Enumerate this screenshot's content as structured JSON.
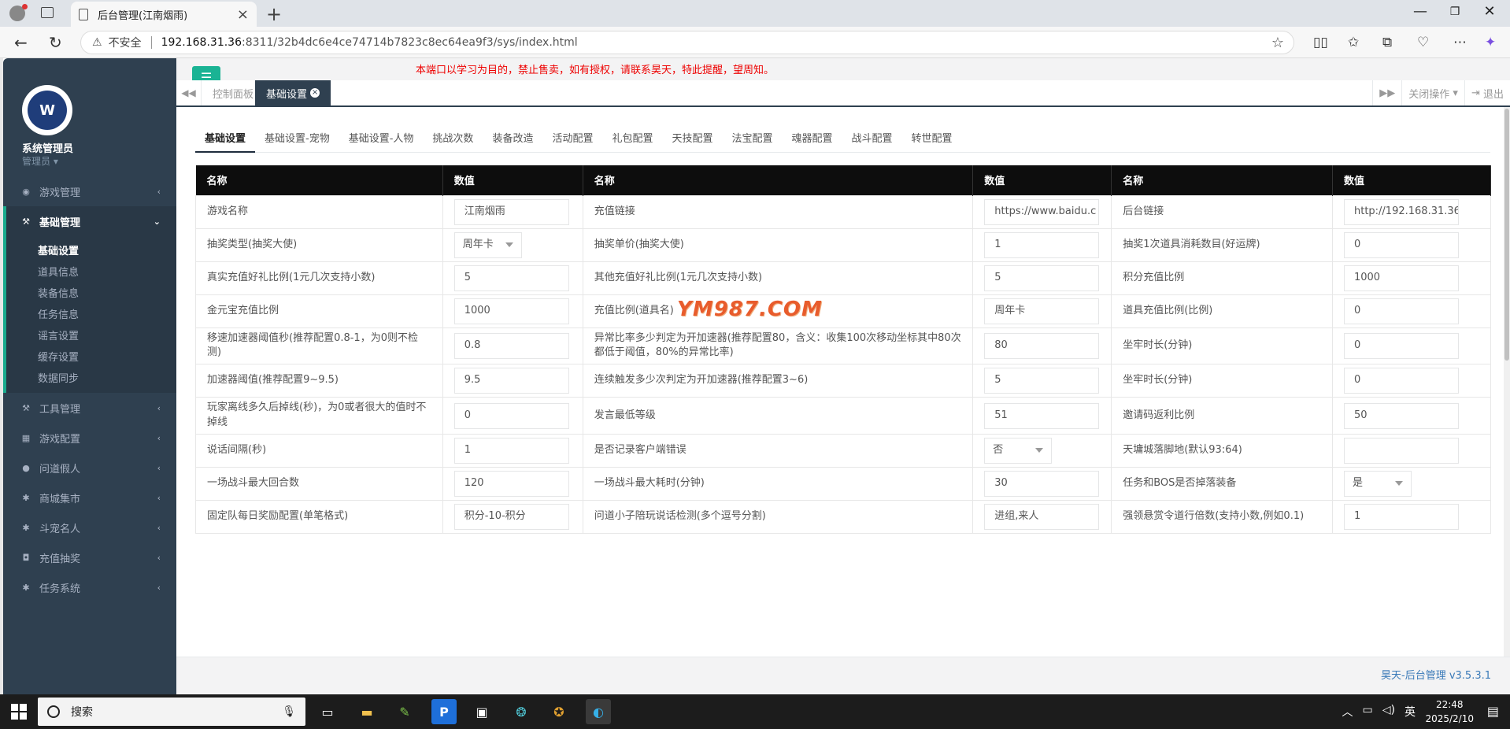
{
  "browser": {
    "tab_title": "后台管理(江南烟雨)",
    "insecure_label": "不安全",
    "url_host": "192.168.31.36",
    "url_path": ":8311/32b4dc6e4ce74714b7823c8ec64ea9f3/sys/index.html"
  },
  "sidebar": {
    "user_name": "系统管理员",
    "user_role": "管理员",
    "logo_text": "W",
    "menu": [
      {
        "label": "游戏管理",
        "icon": "gamepad-icon"
      },
      {
        "label": "基础管理",
        "icon": "cutlery-icon",
        "active": true
      },
      {
        "label": "工具管理",
        "icon": "tools-icon"
      },
      {
        "label": "游戏配置",
        "icon": "grid-icon"
      },
      {
        "label": "问道假人",
        "icon": "user-icon"
      },
      {
        "label": "商城集市",
        "icon": "gear-icon"
      },
      {
        "label": "斗宠名人",
        "icon": "gear-icon"
      },
      {
        "label": "充值抽奖",
        "icon": "camera-icon"
      },
      {
        "label": "任务系统",
        "icon": "gear-icon"
      }
    ],
    "submenu": [
      "基础设置",
      "道具信息",
      "装备信息",
      "任务信息",
      "谣言设置",
      "缓存设置",
      "数据同步"
    ]
  },
  "topbar": {
    "notice": "本端口以学习为目的，禁止售卖，如有授权，请联系昊天，特此提醒，望周知。"
  },
  "page_tabs": {
    "items": [
      "控制面板",
      "基础设置"
    ],
    "close_ops": "关闭操作",
    "logout": "退出"
  },
  "subtabs": [
    "基础设置",
    "基础设置-宠物",
    "基础设置-人物",
    "挑战次数",
    "装备改造",
    "活动配置",
    "礼包配置",
    "天技配置",
    "法宝配置",
    "魂器配置",
    "战斗配置",
    "转世配置"
  ],
  "table": {
    "headers": [
      "名称",
      "数值",
      "名称",
      "数值",
      "名称",
      "数值"
    ],
    "rows": [
      [
        {
          "label": "游戏名称",
          "value": "江南烟雨",
          "type": "input"
        },
        {
          "label": "充值链接",
          "value": "https://www.baidu.c",
          "type": "input"
        },
        {
          "label": "后台链接",
          "value": "http://192.168.31.36",
          "type": "input"
        }
      ],
      [
        {
          "label": "抽奖类型(抽奖大使)",
          "value": "周年卡",
          "type": "select"
        },
        {
          "label": "抽奖单价(抽奖大使)",
          "value": "1",
          "type": "input"
        },
        {
          "label": "抽奖1次道具消耗数目(好运牌)",
          "value": "0",
          "type": "input"
        }
      ],
      [
        {
          "label": "真实充值好礼比例(1元几次支持小数)",
          "value": "5",
          "type": "input"
        },
        {
          "label": "其他充值好礼比例(1元几次支持小数)",
          "value": "5",
          "type": "input"
        },
        {
          "label": "积分充值比例",
          "value": "1000",
          "type": "input"
        }
      ],
      [
        {
          "label": "金元宝充值比例",
          "value": "1000",
          "type": "input"
        },
        {
          "label": "充值比例(道具名)",
          "value": "周年卡",
          "type": "input"
        },
        {
          "label": "道具充值比例(比例)",
          "value": "0",
          "type": "input"
        }
      ],
      [
        {
          "label": "移速加速器阈值秒(推荐配置0.8-1，为0则不检测)",
          "value": "0.8",
          "type": "input"
        },
        {
          "label": "异常比率多少判定为开加速器(推荐配置80，含义：收集100次移动坐标其中80次都低于阈值，80%的异常比率)",
          "value": "80",
          "type": "input"
        },
        {
          "label": "坐牢时长(分钟)",
          "value": "0",
          "type": "input"
        }
      ],
      [
        {
          "label": "加速器阈值(推荐配置9~9.5)",
          "value": "9.5",
          "type": "input"
        },
        {
          "label": "连续触发多少次判定为开加速器(推荐配置3~6)",
          "value": "5",
          "type": "input"
        },
        {
          "label": "坐牢时长(分钟)",
          "value": "0",
          "type": "input"
        }
      ],
      [
        {
          "label": "玩家离线多久后掉线(秒)，为0或者很大的值时不掉线",
          "value": "0",
          "type": "input"
        },
        {
          "label": "发言最低等级",
          "value": "51",
          "type": "input"
        },
        {
          "label": "邀请码返利比例",
          "value": "50",
          "type": "input"
        }
      ],
      [
        {
          "label": "说话间隔(秒)",
          "value": "1",
          "type": "input"
        },
        {
          "label": "是否记录客户端错误",
          "value": "否",
          "type": "select"
        },
        {
          "label": "天墉城落脚地(默认93:64)",
          "value": "",
          "type": "input"
        }
      ],
      [
        {
          "label": "一场战斗最大回合数",
          "value": "120",
          "type": "input"
        },
        {
          "label": "一场战斗最大耗时(分钟)",
          "value": "30",
          "type": "input"
        },
        {
          "label": "任务和BOS是否掉落装备",
          "value": "是",
          "type": "select"
        }
      ],
      [
        {
          "label": "固定队每日奖励配置(单笔格式)",
          "value": "积分-10-积分",
          "type": "input"
        },
        {
          "label": "问道小子陪玩说话检测(多个逗号分割)",
          "value": "进组,来人",
          "type": "input"
        },
        {
          "label": "强领悬赏令道行倍数(支持小数,例如0.1)",
          "value": "1",
          "type": "input"
        }
      ]
    ]
  },
  "watermark": "YM987.COM",
  "footer": {
    "version": "昊天-后台管理 v3.5.3.1"
  },
  "taskbar": {
    "search_placeholder": "搜索",
    "ime": "英",
    "time": "22:48",
    "date": "2025/2/10"
  },
  "colors": {
    "sidebar": "#2f4050",
    "accent": "#1ab394",
    "notice": "#ee0000",
    "header": "#0d0d0d"
  }
}
